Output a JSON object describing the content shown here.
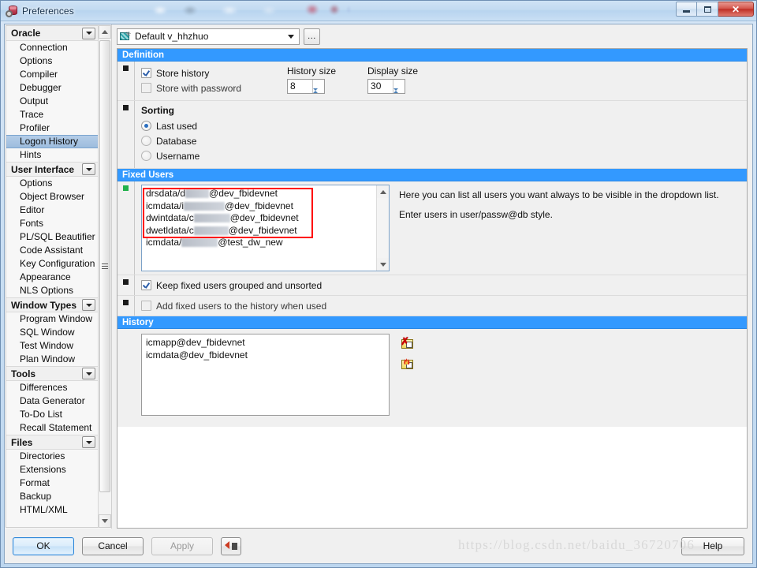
{
  "window": {
    "title": "Preferences",
    "icon": "database-gear-icon",
    "minimize_label": "Minimize",
    "maximize_label": "Maximize",
    "close_label": "Close"
  },
  "profile_bar": {
    "combo_value": "Default v_hhzhuo",
    "combo_icon": "preference-set-icon",
    "ellipsis_label": "..."
  },
  "sidebar": {
    "groups": [
      {
        "label": "Oracle",
        "items": [
          "Connection",
          "Options",
          "Compiler",
          "Debugger",
          "Output",
          "Trace",
          "Profiler",
          "Logon History",
          "Hints"
        ],
        "selected": "Logon History"
      },
      {
        "label": "User Interface",
        "items": [
          "Options",
          "Object Browser",
          "Editor",
          "Fonts",
          "PL/SQL Beautifier",
          "Code Assistant",
          "Key Configuration",
          "Appearance",
          "NLS Options"
        ],
        "selected": null
      },
      {
        "label": "Window Types",
        "items": [
          "Program Window",
          "SQL Window",
          "Test Window",
          "Plan Window"
        ],
        "selected": null
      },
      {
        "label": "Tools",
        "items": [
          "Differences",
          "Data Generator",
          "To-Do List",
          "Recall Statement"
        ],
        "selected": null
      },
      {
        "label": "Files",
        "items": [
          "Directories",
          "Extensions",
          "Format",
          "Backup",
          "HTML/XML"
        ],
        "selected": null
      }
    ]
  },
  "sections": {
    "definition": {
      "header": "Definition",
      "store_history_label": "Store history",
      "store_history_checked": true,
      "store_with_password_label": "Store with password",
      "store_with_password_checked": false,
      "history_size_label": "History size",
      "history_size_value": "8",
      "display_size_label": "Display size",
      "display_size_value": "30",
      "sorting_title": "Sorting",
      "sorting_options": [
        "Last used",
        "Database",
        "Username"
      ],
      "sorting_selected": "Last used"
    },
    "fixed_users": {
      "header": "Fixed Users",
      "entries": [
        {
          "prefix": "drsdata/d",
          "redact_width": 30,
          "suffix": "@dev_fbidevnet"
        },
        {
          "prefix": "icmdata/i",
          "redact_width": 52,
          "suffix": "@dev_fbidevnet"
        },
        {
          "prefix": "dwintdata/c",
          "redact_width": 46,
          "suffix": "@dev_fbidevnet"
        },
        {
          "prefix": "dwetldata/c",
          "redact_width": 44,
          "suffix": "@dev_fbidevnet"
        },
        {
          "prefix": "icmdata/",
          "redact_width": 46,
          "suffix": "@test_dw_new"
        }
      ],
      "help_paragraph_1": "Here you can list all users you want always to be visible in the dropdown list.",
      "help_paragraph_2": "Enter users in user/passw@db style.",
      "keep_grouped_label": "Keep fixed users grouped and unsorted",
      "keep_grouped_checked": true,
      "add_to_history_label": "Add fixed users to the history when used",
      "add_to_history_checked": false
    },
    "history": {
      "header": "History",
      "entries": [
        "icmapp@dev_fbidevnet",
        "icmdata@dev_fbidevnet"
      ],
      "tools": [
        {
          "icon": "delete-history-entry-icon",
          "label": "Delete entry"
        },
        {
          "icon": "clear-history-icon",
          "label": "Clear history"
        }
      ]
    }
  },
  "buttons": {
    "ok": "OK",
    "cancel": "Cancel",
    "apply": "Apply",
    "apply_disabled": true,
    "import_export_icon": "import-export-icon",
    "help": "Help"
  },
  "watermark": "https://blog.csdn.net/baidu_36720706",
  "colors": {
    "section_header_bg": "#3399ff",
    "selection_bg": "#9dbcdd",
    "highlight_box": "#ff0000",
    "close_button": "#bf2f26"
  }
}
